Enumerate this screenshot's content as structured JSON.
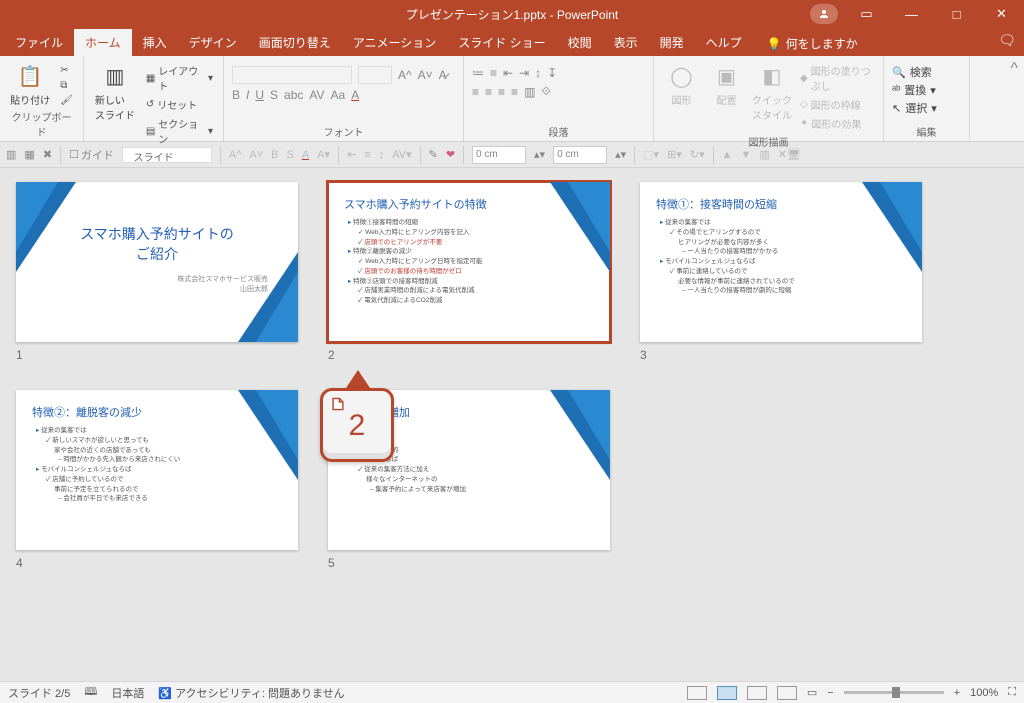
{
  "app": {
    "title": "プレゼンテーション1.pptx  -  PowerPoint"
  },
  "tabs": {
    "file": "ファイル",
    "home": "ホーム",
    "insert": "挿入",
    "design": "デザイン",
    "transitions": "画面切り替え",
    "animations": "アニメーション",
    "slideshow": "スライド ショー",
    "review": "校閲",
    "view": "表示",
    "developer": "開発",
    "help": "ヘルプ",
    "tellme": "何をしますか"
  },
  "ribbon": {
    "clipboard": {
      "paste": "貼り付け",
      "label": "クリップボード"
    },
    "slides": {
      "newslide": "新しい\nスライド",
      "layout": "レイアウト",
      "reset": "リセット",
      "section": "セクション",
      "label": "スライド"
    },
    "font": {
      "label": "フォント"
    },
    "paragraph": {
      "label": "段落"
    },
    "drawing": {
      "shapes": "図形",
      "arrange": "配置",
      "quickstyles": "クイック\nスタイル",
      "fill": "図形の塗りつぶし",
      "outline": "図形の枠線",
      "effects": "図形の効果",
      "label": "図形描画"
    },
    "editing": {
      "find": "検索",
      "replace": "置換",
      "select": "選択",
      "label": "編集"
    }
  },
  "graybar": {
    "guide": "ガイド",
    "measure": "0 cm"
  },
  "slides": [
    {
      "num": "1",
      "title": "スマホ購入予約サイトの\nご紹介",
      "sub": "株式会社スマホサービス販売\n山田太郎"
    },
    {
      "num": "2",
      "title": "スマホ購入予約サイトの特徴",
      "body": [
        {
          "t": "特徴①接客時間の短縮",
          "cls": "bullet"
        },
        {
          "t": "Web入力時にヒアリング内容を記入",
          "cls": "check"
        },
        {
          "t": "店頭でのヒアリングが不要",
          "cls": "check hl-red"
        },
        {
          "t": "特徴②離脱客の減少",
          "cls": "bullet"
        },
        {
          "t": "Web入力時にヒアリング日時を指定可能",
          "cls": "check"
        },
        {
          "t": "店頭でのお客様の待ち時間がゼロ",
          "cls": "check hl-red"
        },
        {
          "t": "特徴③店頭での接客時間削減",
          "cls": "bullet"
        },
        {
          "t": "店舗実業時間の削減による電気代削減",
          "cls": "check"
        },
        {
          "t": "電気代削減によるCO2削減",
          "cls": "check"
        }
      ]
    },
    {
      "num": "3",
      "title": "特徴①：接客時間の短縮",
      "body": [
        {
          "t": "従来の集客では",
          "cls": "bullet"
        },
        {
          "t": "その場でヒアリングするので",
          "cls": "check"
        },
        {
          "t": "ヒアリングが必要な内容が多く",
          "cls": ""
        },
        {
          "t": "一人当たりの接客時間がかかる",
          "cls": "dash"
        },
        {
          "t": "モバイルコンシェルジュならば",
          "cls": "bullet"
        },
        {
          "t": "事前に連絡しているので",
          "cls": "check"
        },
        {
          "t": "必要な情報が事前に連絡されているので",
          "cls": ""
        },
        {
          "t": "一人当たりの接客時間が劇的に短縮",
          "cls": "dash"
        }
      ]
    },
    {
      "num": "4",
      "title": "特徴②：離脱客の減少",
      "body": [
        {
          "t": "従来の集客では",
          "cls": "bullet"
        },
        {
          "t": "新しいスマホが欲しいと思っても",
          "cls": "check"
        },
        {
          "t": "家や会社の近くの店舗であっても",
          "cls": ""
        },
        {
          "t": "時間がかかる先入観から来店されにくい",
          "cls": "dash"
        },
        {
          "t": "モバイルコンシェルジュならば",
          "cls": "bullet"
        },
        {
          "t": "店舗に予約しているので",
          "cls": "check"
        },
        {
          "t": "事前に予定を立てられるので",
          "cls": ""
        },
        {
          "t": "会社員が平日でも来店できる",
          "cls": "dash"
        }
      ]
    },
    {
      "num": "5",
      "title": "来店客の増加",
      "body": [
        {
          "t": "では",
          "cls": "bullet"
        },
        {
          "t": "こっては",
          "cls": "check"
        },
        {
          "t": "業が限定的",
          "cls": ""
        },
        {
          "t": "ェルジュならば",
          "cls": "bullet"
        },
        {
          "t": "従来の集客方法に加え",
          "cls": "check"
        },
        {
          "t": "様々なインターネットの",
          "cls": ""
        },
        {
          "t": "集客予約によって来店客が増加",
          "cls": "dash"
        }
      ]
    }
  ],
  "callout": {
    "key": "2"
  },
  "status": {
    "slide": "スライド 2/5",
    "lang": "日本語",
    "a11y": "アクセシビリティ: 問題ありません",
    "zoom": "100%"
  }
}
